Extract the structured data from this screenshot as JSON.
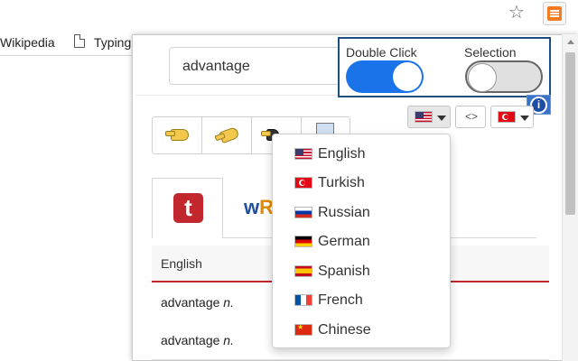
{
  "browser": {
    "bookmarks": [
      "Wikipedia",
      "Typing"
    ],
    "star_icon": "star-icon",
    "extension_icon": "translator-extension-icon"
  },
  "popup": {
    "search": {
      "value": "advantage"
    },
    "toggles": {
      "double_click": {
        "label": "Double Click",
        "state": "on"
      },
      "selection": {
        "label": "Selection",
        "state": "off"
      }
    },
    "info_badge": "i",
    "language_bar": {
      "source_flag": "us-flag",
      "swap_label": "<>",
      "target_flag": "tr-flag"
    },
    "tools": [
      "hand-left-icon",
      "hand-right-icon",
      "hand-up-icon",
      "document-icon"
    ],
    "dict_tabs": [
      {
        "logo": "t",
        "name": "tureng-logo"
      },
      {
        "logo_a": "w",
        "logo_b": "R",
        "name": "wordreference-logo"
      }
    ],
    "table": {
      "header": "English",
      "rows": [
        {
          "word": "advantage",
          "pos": "n."
        },
        {
          "word": "advantage",
          "pos": "n."
        }
      ]
    },
    "dropdown": {
      "options": [
        {
          "label": "English",
          "flag": "f-us"
        },
        {
          "label": "Turkish",
          "flag": "f-tr"
        },
        {
          "label": "Russian",
          "flag": "f-ru"
        },
        {
          "label": "German",
          "flag": "f-de"
        },
        {
          "label": "Spanish",
          "flag": "f-es"
        },
        {
          "label": "French",
          "flag": "f-fr"
        },
        {
          "label": "Chinese",
          "flag": "f-cn"
        }
      ]
    }
  },
  "colors": {
    "toggle_on": "#1a73e8",
    "panel_border": "#1f4f7f",
    "accent_red": "#c1272d"
  }
}
